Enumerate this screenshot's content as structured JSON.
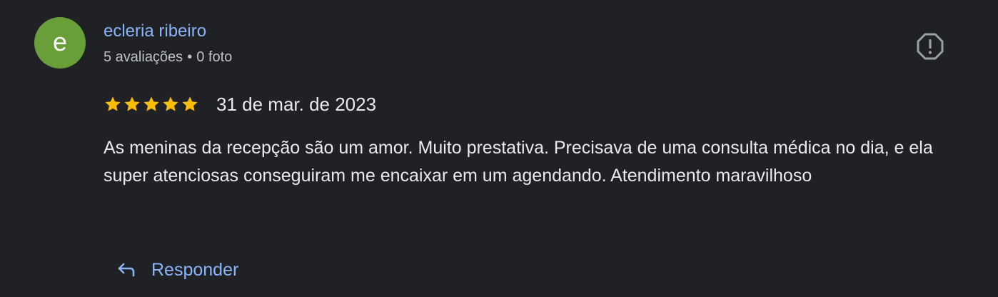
{
  "review": {
    "author": {
      "avatar_letter": "e",
      "avatar_color": "#689f38",
      "name": "ecleria ribeiro",
      "reviews_count": "5 avaliações",
      "separator": "•",
      "photos_count": "0 foto"
    },
    "rating": 5,
    "rating_max": 5,
    "star_color": "#fbbc04",
    "date": "31 de mar. de 2023",
    "text": "As meninas da recepção são um amor. Muito prestativa. Precisava de uma consulta médica no dia, e ela super atenciosas conseguiram me encaixar em um agendando. Atendimento maravilhoso",
    "reply_label": "Responder",
    "icons": {
      "report": "report-flag-icon",
      "reply": "reply-arrow-icon"
    },
    "colors": {
      "background": "#202124",
      "link": "#8ab4f8",
      "text": "#e8eaed",
      "secondary_text": "#bdc1c6"
    }
  }
}
